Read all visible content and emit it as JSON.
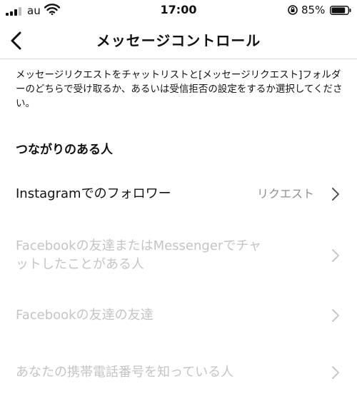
{
  "status_bar": {
    "carrier": "au",
    "time": "17:00",
    "battery_percent": "85%",
    "battery_level": 0.85,
    "icons": [
      "signal-icon",
      "wifi-icon",
      "rotation-lock-icon",
      "battery-icon"
    ]
  },
  "header": {
    "title": "メッセージコントロール",
    "back_icon": "chevron-left-icon"
  },
  "description": "メッセージリクエストをチャットリストと[メッセージリクエスト]フォルダーのどちらで受け取るか、あるいは受信拒否の設定をするか選択してください。",
  "section": {
    "title": "つながりのある人",
    "rows": [
      {
        "label": "Instagramでのフォロワー",
        "value": "リクエスト",
        "enabled": true
      },
      {
        "label_line1": "Facebookの友達またはMessengerでチャ",
        "label_line2": "ットしたことがある人",
        "enabled": false
      },
      {
        "label": "Facebookの友達の友達",
        "enabled": false
      },
      {
        "label": "あなたの携帯電話番号を知っている人",
        "enabled": false
      }
    ]
  },
  "colors": {
    "text": "#111111",
    "muted_text": "#8e8e8e",
    "disabled_text": "#c4c4c4",
    "chevron": "#555555",
    "chevron_disabled": "#c8c8c8",
    "divider": "#d8d8d8"
  }
}
